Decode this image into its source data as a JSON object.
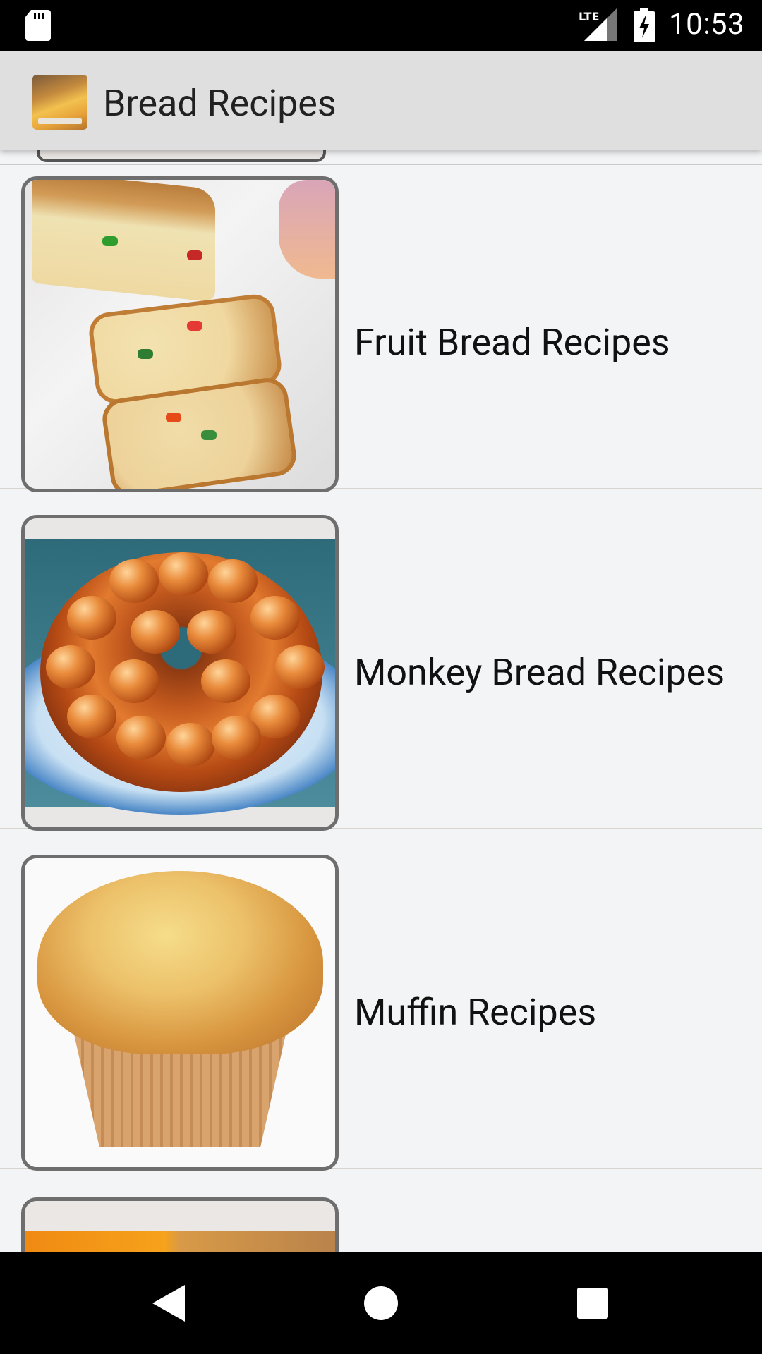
{
  "status_bar": {
    "time": "10:53",
    "network": "LTE",
    "icons": [
      "sd-card-icon",
      "lte-signal-icon",
      "battery-charging-icon"
    ]
  },
  "app_bar": {
    "title": "Bread Recipes",
    "icon": "bread-recipes-app-icon"
  },
  "recipes": [
    {
      "label": "Fruit Bread Recipes",
      "image": "fruit-bread-image"
    },
    {
      "label": "Monkey Bread Recipes",
      "image": "monkey-bread-image"
    },
    {
      "label": "Muffin Recipes",
      "image": "muffin-image"
    }
  ],
  "nav_bar": {
    "icons": [
      "back-icon",
      "home-icon",
      "recents-icon"
    ]
  },
  "colors": {
    "app_bar_bg": "#dfdfdf",
    "list_bg": "#f3f4f6",
    "status_bar_bg": "#000000",
    "nav_bar_bg": "#000000"
  }
}
